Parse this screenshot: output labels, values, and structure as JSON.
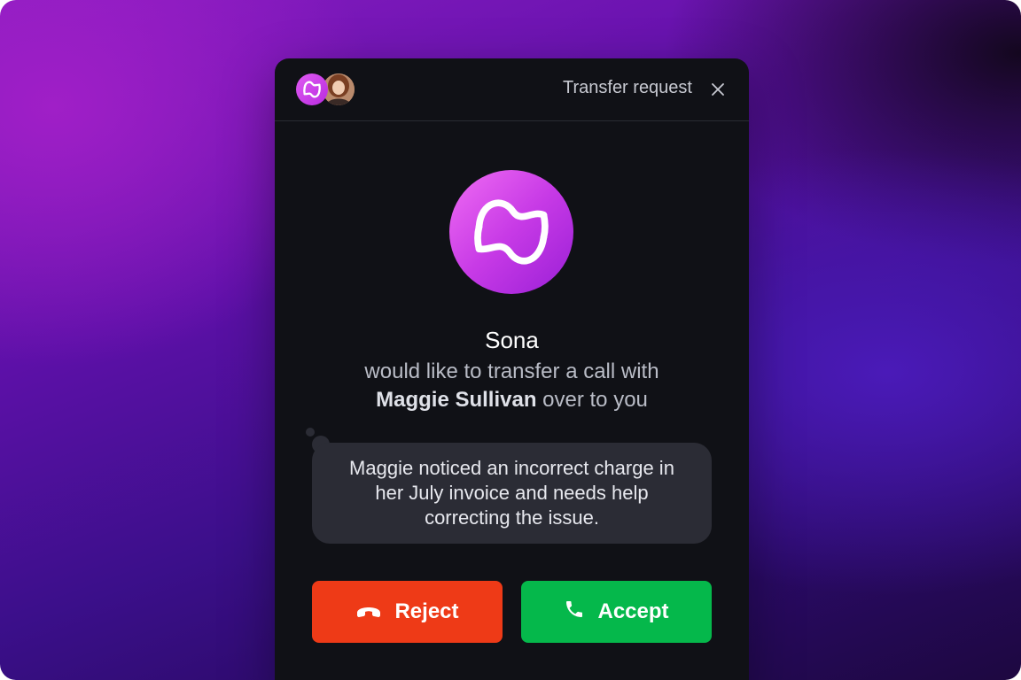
{
  "header": {
    "title": "Transfer request",
    "close_icon": "close-icon"
  },
  "caller": {
    "name": "Sona",
    "message_line1": "would like to transfer a call with",
    "customer_name": "Maggie Sullivan",
    "message_line2_suffix": " over to you"
  },
  "note": {
    "text": "Maggie noticed an incorrect charge in her July invoice and needs help correcting the issue."
  },
  "actions": {
    "reject_label": "Reject",
    "accept_label": "Accept",
    "reject_icon": "phone-hangup-icon",
    "accept_icon": "phone-icon"
  },
  "colors": {
    "reject": "#ee3a17",
    "accept": "#05b84b",
    "brand": "#c73ae6",
    "panel": "#101116"
  }
}
